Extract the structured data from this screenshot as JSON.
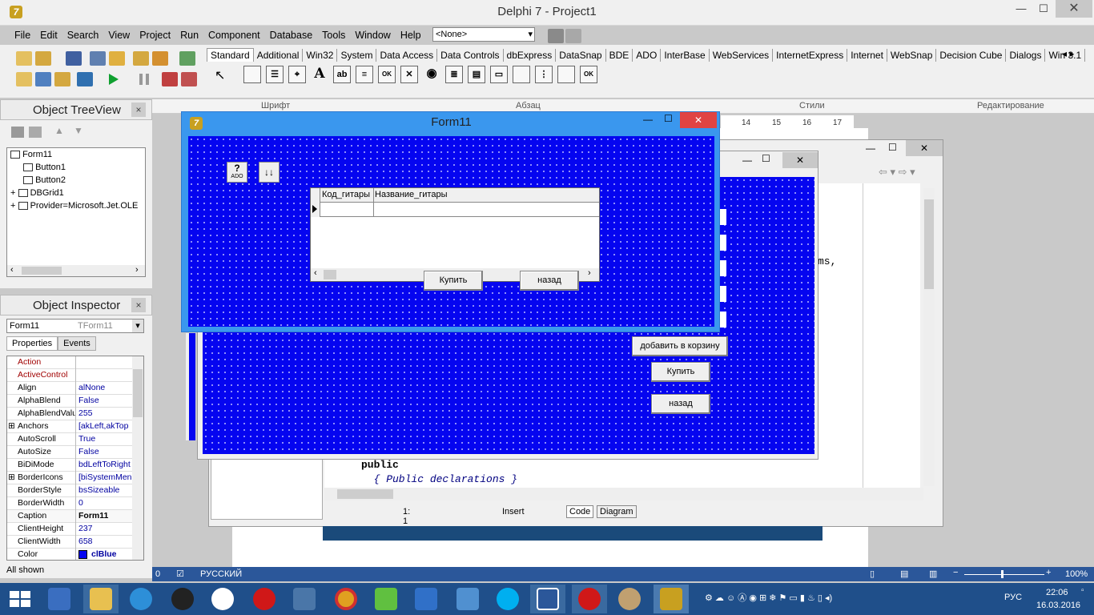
{
  "app": {
    "title": "Delphi 7 - Project1",
    "logo": "7"
  },
  "menu": [
    "File",
    "Edit",
    "Search",
    "View",
    "Project",
    "Run",
    "Component",
    "Database",
    "Tools",
    "Window",
    "Help"
  ],
  "toolbar": {
    "config_combo": "<None>"
  },
  "palette_tabs": [
    "Standard",
    "Additional",
    "Win32",
    "System",
    "Data Access",
    "Data Controls",
    "dbExpress",
    "DataSnap",
    "BDE",
    "ADO",
    "InterBase",
    "WebServices",
    "InternetExpress",
    "Internet",
    "WebSnap",
    "Decision Cube",
    "Dialogs",
    "Win 3.1"
  ],
  "palette_icons": [
    "Frames",
    "MainMenu",
    "PopupMenu",
    "Label",
    "Edit",
    "Memo",
    "Button",
    "CheckBox",
    "RadioButton",
    "ListBox",
    "ComboBox",
    "ScrollBar",
    "GroupBox",
    "RadioGroup",
    "Panel",
    "ActionList"
  ],
  "treeview": {
    "title": "Object TreeView",
    "items": [
      {
        "label": "Form11",
        "expander": ""
      },
      {
        "label": "Button1",
        "expander": ""
      },
      {
        "label": "Button2",
        "expander": ""
      },
      {
        "label": "DBGrid1",
        "expander": "+"
      },
      {
        "label": "Provider=Microsoft.Jet.OLE",
        "expander": "+"
      }
    ]
  },
  "inspector": {
    "title": "Object Inspector",
    "object_name": "Form11",
    "object_type": "TForm11",
    "tabs": [
      "Properties",
      "Events"
    ],
    "rows": [
      {
        "name": "Action",
        "value": "",
        "expander": "",
        "kind": "red"
      },
      {
        "name": "ActiveControl",
        "value": "",
        "expander": "",
        "kind": "red"
      },
      {
        "name": "Align",
        "value": "alNone",
        "expander": "",
        "kind": ""
      },
      {
        "name": "AlphaBlend",
        "value": "False",
        "expander": "",
        "kind": ""
      },
      {
        "name": "AlphaBlendValu",
        "value": "255",
        "expander": "",
        "kind": ""
      },
      {
        "name": "Anchors",
        "value": "[akLeft,akTop",
        "expander": "⊞",
        "kind": ""
      },
      {
        "name": "AutoScroll",
        "value": "True",
        "expander": "",
        "kind": ""
      },
      {
        "name": "AutoSize",
        "value": "False",
        "expander": "",
        "kind": ""
      },
      {
        "name": "BiDiMode",
        "value": "bdLeftToRight",
        "expander": "",
        "kind": ""
      },
      {
        "name": "BorderIcons",
        "value": "[biSystemMen",
        "expander": "⊞",
        "kind": ""
      },
      {
        "name": "BorderStyle",
        "value": "bsSizeable",
        "expander": "",
        "kind": ""
      },
      {
        "name": "BorderWidth",
        "value": "0",
        "expander": "",
        "kind": ""
      },
      {
        "name": "Caption",
        "value": "Form11",
        "expander": "",
        "kind": "sel"
      },
      {
        "name": "ClientHeight",
        "value": "237",
        "expander": "",
        "kind": ""
      },
      {
        "name": "ClientWidth",
        "value": "658",
        "expander": "",
        "kind": ""
      },
      {
        "name": "Color",
        "value": "clBlue",
        "expander": "",
        "kind": "color"
      }
    ],
    "footer": "All shown"
  },
  "word_ribbon": {
    "font": "Шрифт",
    "paragraph": "Абзац",
    "styles": "Стили",
    "editing": "Редактирование"
  },
  "ruler": [
    "14",
    "15",
    "16",
    "17"
  ],
  "code": [
    "ms,",
    "public",
    "  { Public declarations }"
  ],
  "editor_status": {
    "pos": "1:  1",
    "mode": "Insert",
    "tab_code": "Code",
    "tab_diagram": "Diagram"
  },
  "form2": {
    "btn_add": "добавить в корзину",
    "btn_buy": "Купить",
    "btn_back": "назад"
  },
  "form11": {
    "title": "Form11",
    "columns": [
      "Код_гитары",
      "Название_гитары"
    ],
    "btn_buy": "Купить",
    "btn_back": "назад",
    "ado_label": "ADO"
  },
  "word_status": {
    "page": "0",
    "lang": "РУССКИЙ",
    "zoom": "100%"
  },
  "tray": {
    "lang": "РУС",
    "time": "22:06",
    "date": "16.03.2016"
  },
  "colors": {
    "form_bg": "#0505f0",
    "taskbar": "#1f4f8a",
    "word_status": "#2b579a"
  }
}
